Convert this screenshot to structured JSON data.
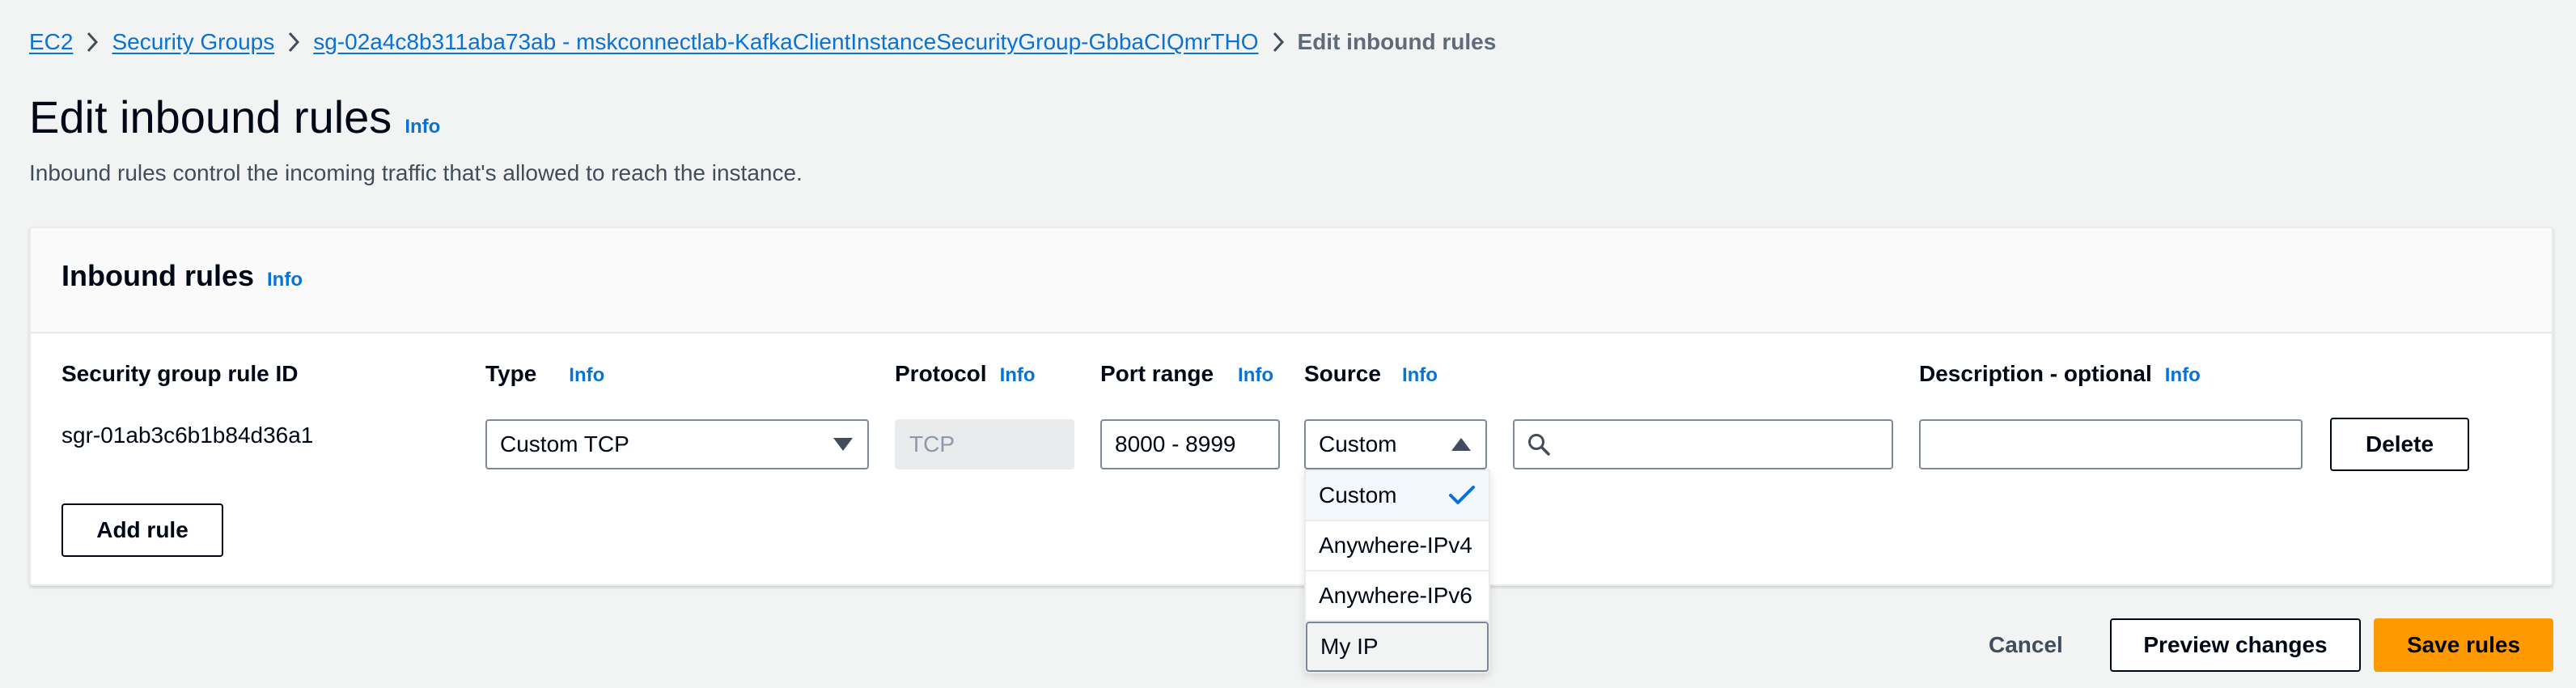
{
  "breadcrumb": {
    "items": [
      "EC2",
      "Security Groups",
      "sg-02a4c8b311aba73ab - mskconnectlab-KafkaClientInstanceSecurityGroup-GbbaCIQmrTHO"
    ],
    "current": "Edit inbound rules"
  },
  "page": {
    "title": "Edit inbound rules",
    "info": "Info",
    "description": "Inbound rules control the incoming traffic that's allowed to reach the instance."
  },
  "panel": {
    "title": "Inbound rules",
    "info": "Info",
    "columns": {
      "rule_id": "Security group rule ID",
      "type": "Type",
      "protocol": "Protocol",
      "port_range": "Port range",
      "source": "Source",
      "description": "Description - optional"
    },
    "column_info": "Info"
  },
  "rule": {
    "id": "sgr-01ab3c6b1b84d36a1",
    "type": "Custom TCP",
    "protocol": "TCP",
    "port_range": "8000 - 8999",
    "source": "Custom",
    "source_search": "",
    "description": "",
    "delete_label": "Delete"
  },
  "source_options": [
    "Custom",
    "Anywhere-IPv4",
    "Anywhere-IPv6",
    "My IP"
  ],
  "add_rule_label": "Add rule",
  "footer": {
    "cancel": "Cancel",
    "preview": "Preview changes",
    "save": "Save rules"
  },
  "colors": {
    "link": "#0972d3",
    "primary": "#ff9900",
    "background": "#f2f3f3"
  }
}
